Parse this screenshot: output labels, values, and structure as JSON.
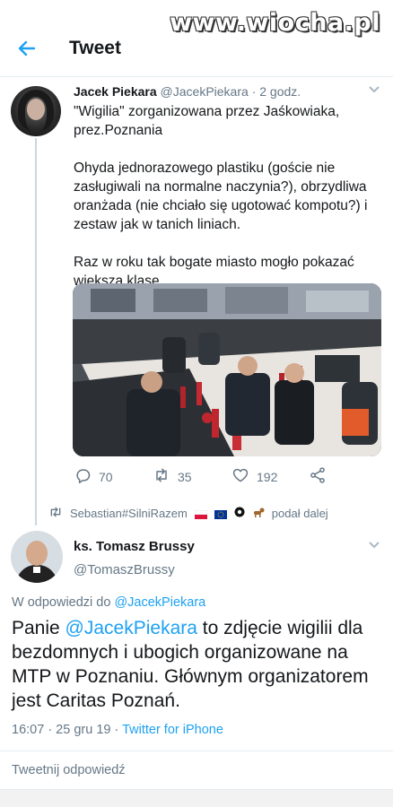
{
  "watermark": "www.wiocha.pl",
  "header": {
    "title": "Tweet"
  },
  "tweet1": {
    "name": "Jacek Piekara",
    "handle": "@JacekPiekara",
    "time": "· 2 godz.",
    "paragraphs": [
      "\"Wigilia\" zorganizowana przez Jaśkowiaka, prez.Poznania",
      "Ohyda jednorazowego plastiku (goście nie zasługiwali na normalne naczynia?), obrzydliwa oranżada (nie chciało się ugotować kompotu?) i zestaw jak w tanich liniach.",
      "Raz w roku tak bogate miasto mogło pokazać większą klasę."
    ],
    "replies": "70",
    "retweets": "35",
    "likes": "192"
  },
  "retweeted_by": {
    "name": "Sebastian#SilniRazem",
    "suffix": "podał dalej"
  },
  "tweet2": {
    "name": "ks. Tomasz Brussy",
    "handle": "@TomaszBrussy",
    "reply_prefix": "W odpowiedzi do",
    "reply_handle": "@JacekPiekara",
    "text_before": "Panie ",
    "text_mention": "@JacekPiekara",
    "text_after": " to zdjęcie wigilii dla bezdomnych i ubogich organizowane na MTP w Poznaniu. Głównym organizatorem jest Caritas Poznań.",
    "timestamp": "16:07 · 25 gru 19 · ",
    "source": "Twitter for iPhone"
  },
  "reply_placeholder": "Tweetnij odpowiedź",
  "colors": {
    "accent": "#1da1f2",
    "secondary_text": "#657786"
  },
  "icons": [
    "back-arrow-icon",
    "chevron-down-icon",
    "reply-icon",
    "retweet-icon",
    "like-icon",
    "share-icon",
    "retweet-small-icon"
  ]
}
